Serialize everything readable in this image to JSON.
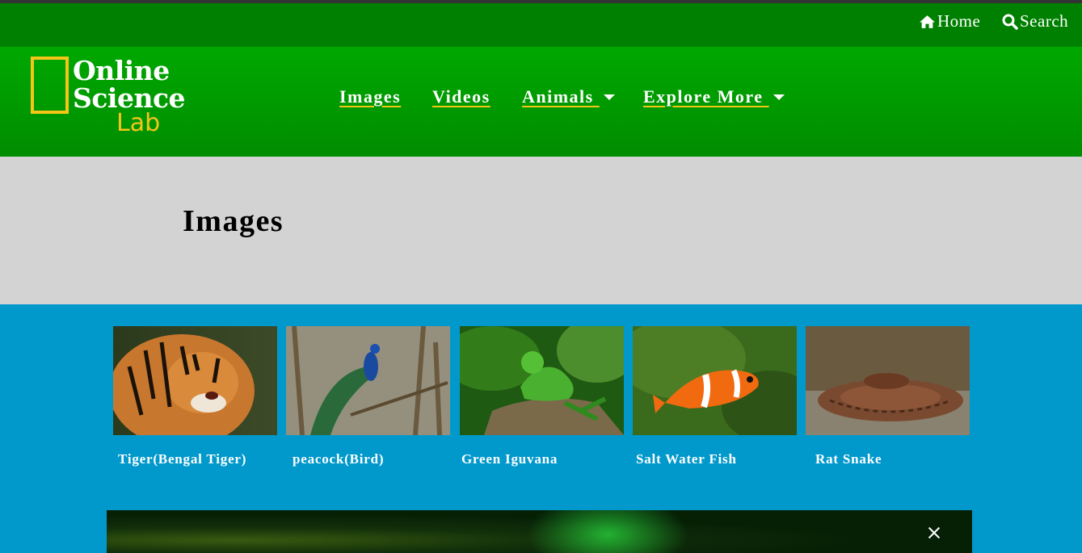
{
  "topbar": {
    "home_label": "Home",
    "search_label": "Search"
  },
  "logo": {
    "line1": "Online",
    "line2": "Science",
    "line3": "Lab"
  },
  "nav": {
    "images": "Images",
    "videos": "Videos",
    "animals": "Animals ",
    "explore": "Explore More "
  },
  "page": {
    "title": "Images"
  },
  "cards": [
    {
      "caption": "Tiger(Bengal Tiger)"
    },
    {
      "caption": "peacock(Bird)"
    },
    {
      "caption": "Green Iguvana"
    },
    {
      "caption": "Salt Water Fish"
    },
    {
      "caption": "Rat Snake"
    }
  ],
  "colors": {
    "topbar": "#008000",
    "navbar": "#00a800",
    "accent": "#f5c518",
    "hero": "#d3d3d3",
    "gallery": "#0199cc"
  },
  "icons": {
    "home": "home-icon",
    "search": "search-icon",
    "dropdown": "caret-down-icon",
    "close": "close-icon"
  }
}
